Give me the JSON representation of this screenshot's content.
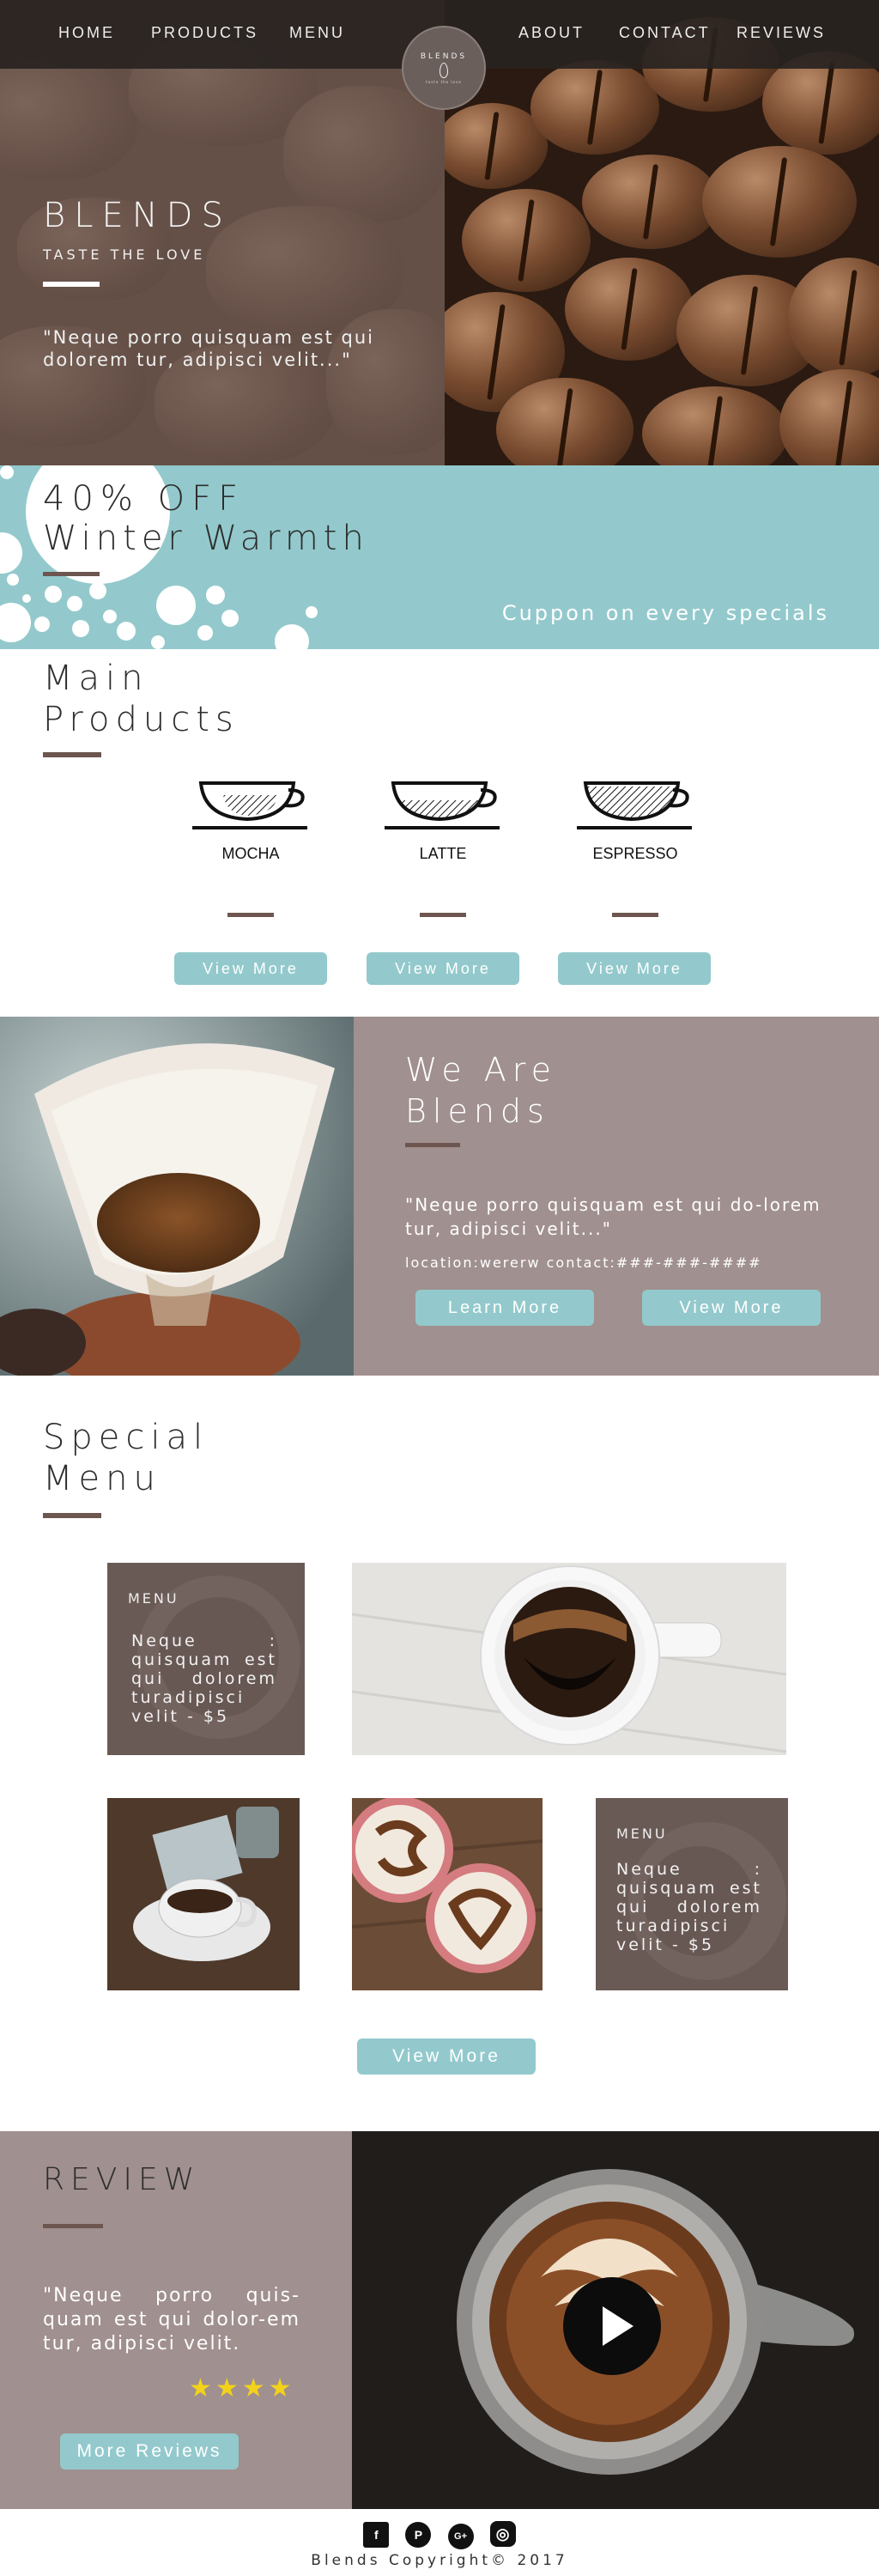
{
  "nav": {
    "left": [
      "HOME",
      "PRODUCTS",
      "MENU"
    ],
    "right": [
      "ABOUT",
      "CONTACT",
      "REVIEWS"
    ],
    "logo_text": "BLENDS",
    "logo_tagline": "taste the love",
    "logo_icon": "leaf-icon"
  },
  "hero": {
    "title": "BLENDS",
    "subtitle": "TASTE THE LOVE",
    "quote": "\"Neque porro quisquam est qui dolorem tur, adipisci velit...\""
  },
  "promo": {
    "discount": "40% OFF",
    "title": "Winter Warmth",
    "coupon": "Cuppon on every specials"
  },
  "products": {
    "heading_line1": "Main",
    "heading_line2": "Products",
    "items": [
      {
        "name": "MOCHA",
        "button": "View More",
        "icon": "coffee-cup-icon"
      },
      {
        "name": "LATTE",
        "button": "View More",
        "icon": "coffee-cup-icon"
      },
      {
        "name": "ESPRESSO",
        "button": "View More",
        "icon": "coffee-cup-icon"
      }
    ]
  },
  "about": {
    "title_line1": "We Are",
    "title_line2": "Blends",
    "quote": "\"Neque porro quisquam est qui do-lorem tur, adipisci velit...\"",
    "location": "location:wererw  contact:###-###-####",
    "learn_more": "Learn More",
    "view_more": "View More"
  },
  "special": {
    "heading_line1": "Special",
    "heading_line2": "Menu",
    "menu_tile_1": {
      "title": "MENU",
      "text": "Neque : quisquam est qui dolorem turadipisci velit  - $5"
    },
    "menu_tile_2": {
      "title": "MENU",
      "text": "Neque : quisquam est qui dolorem turadipisci velit  - $5"
    },
    "button": "View More"
  },
  "review": {
    "title": "REVIEW",
    "quote": "\"Neque porro quis-quam est qui dolor-em tur, adipisci velit.",
    "stars": "★★★★",
    "rating": 4,
    "button": "More Reviews",
    "play_icon": "play-icon"
  },
  "footer": {
    "social": [
      {
        "icon": "facebook-icon",
        "glyph": "f"
      },
      {
        "icon": "pinterest-icon",
        "glyph": "P"
      },
      {
        "icon": "google-plus-icon",
        "glyph": "G+"
      },
      {
        "icon": "instagram-icon",
        "glyph": "◎"
      }
    ],
    "copyright": "Blends Copyright© 2017"
  },
  "colors": {
    "accent_teal": "#93c9cc",
    "panel_mauve": "#a0908f",
    "bar_brown": "#6d5650",
    "star_yellow": "#f3d21b"
  }
}
